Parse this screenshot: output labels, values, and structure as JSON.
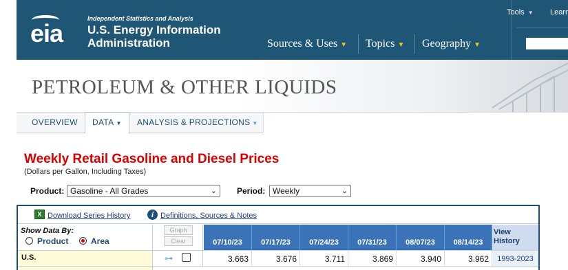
{
  "header": {
    "logo_text": "eia",
    "org_tagline": "Independent Statistics and Analysis",
    "org_name_line1": "U.S. Energy Information",
    "org_name_line2": "Administration",
    "nav": [
      {
        "label": "Sources & Uses"
      },
      {
        "label": "Topics"
      },
      {
        "label": "Geography"
      }
    ],
    "utility": [
      {
        "label": "Tools"
      },
      {
        "label": "Learn"
      }
    ],
    "search_placeholder": "",
    "colors": {
      "header_bg": "#1f5575",
      "caret": "#f0c419"
    }
  },
  "banner": {
    "title": "PETROLEUM & OTHER LIQUIDS"
  },
  "tabs": [
    {
      "label": "OVERVIEW",
      "active": false
    },
    {
      "label": "DATA",
      "active": true
    },
    {
      "label": "ANALYSIS & PROJECTIONS",
      "active": false
    }
  ],
  "content": {
    "title": "Weekly Retail Gasoline and Diesel Prices",
    "subtitle": "(Dollars per Gallon, Including Taxes)",
    "product_label": "Product:",
    "product_value": "Gasoline - All Grades",
    "period_label": "Period:",
    "period_value": "Weekly",
    "colors": {
      "title": "#d90000",
      "table_header": "#3a73b8",
      "row_label_bg": "#fefbd9"
    }
  },
  "table": {
    "download_link": "Download Series History",
    "definitions_link": "Definitions, Sources & Notes",
    "show_by_label": "Show Data By:",
    "radio_product": "Product",
    "radio_area": "Area",
    "selected": "Area",
    "graph_button": "Graph",
    "clear_button": "Clear",
    "dates": [
      "07/10/23",
      "07/17/23",
      "07/24/23",
      "07/31/23",
      "08/07/23",
      "08/14/23"
    ],
    "view_history_line1": "View",
    "view_history_line2": "History",
    "rows": [
      {
        "name": "U.S.",
        "values": [
          "3.663",
          "3.676",
          "3.711",
          "3.869",
          "3.940",
          "3.962"
        ],
        "history": "1993-2023"
      }
    ]
  }
}
